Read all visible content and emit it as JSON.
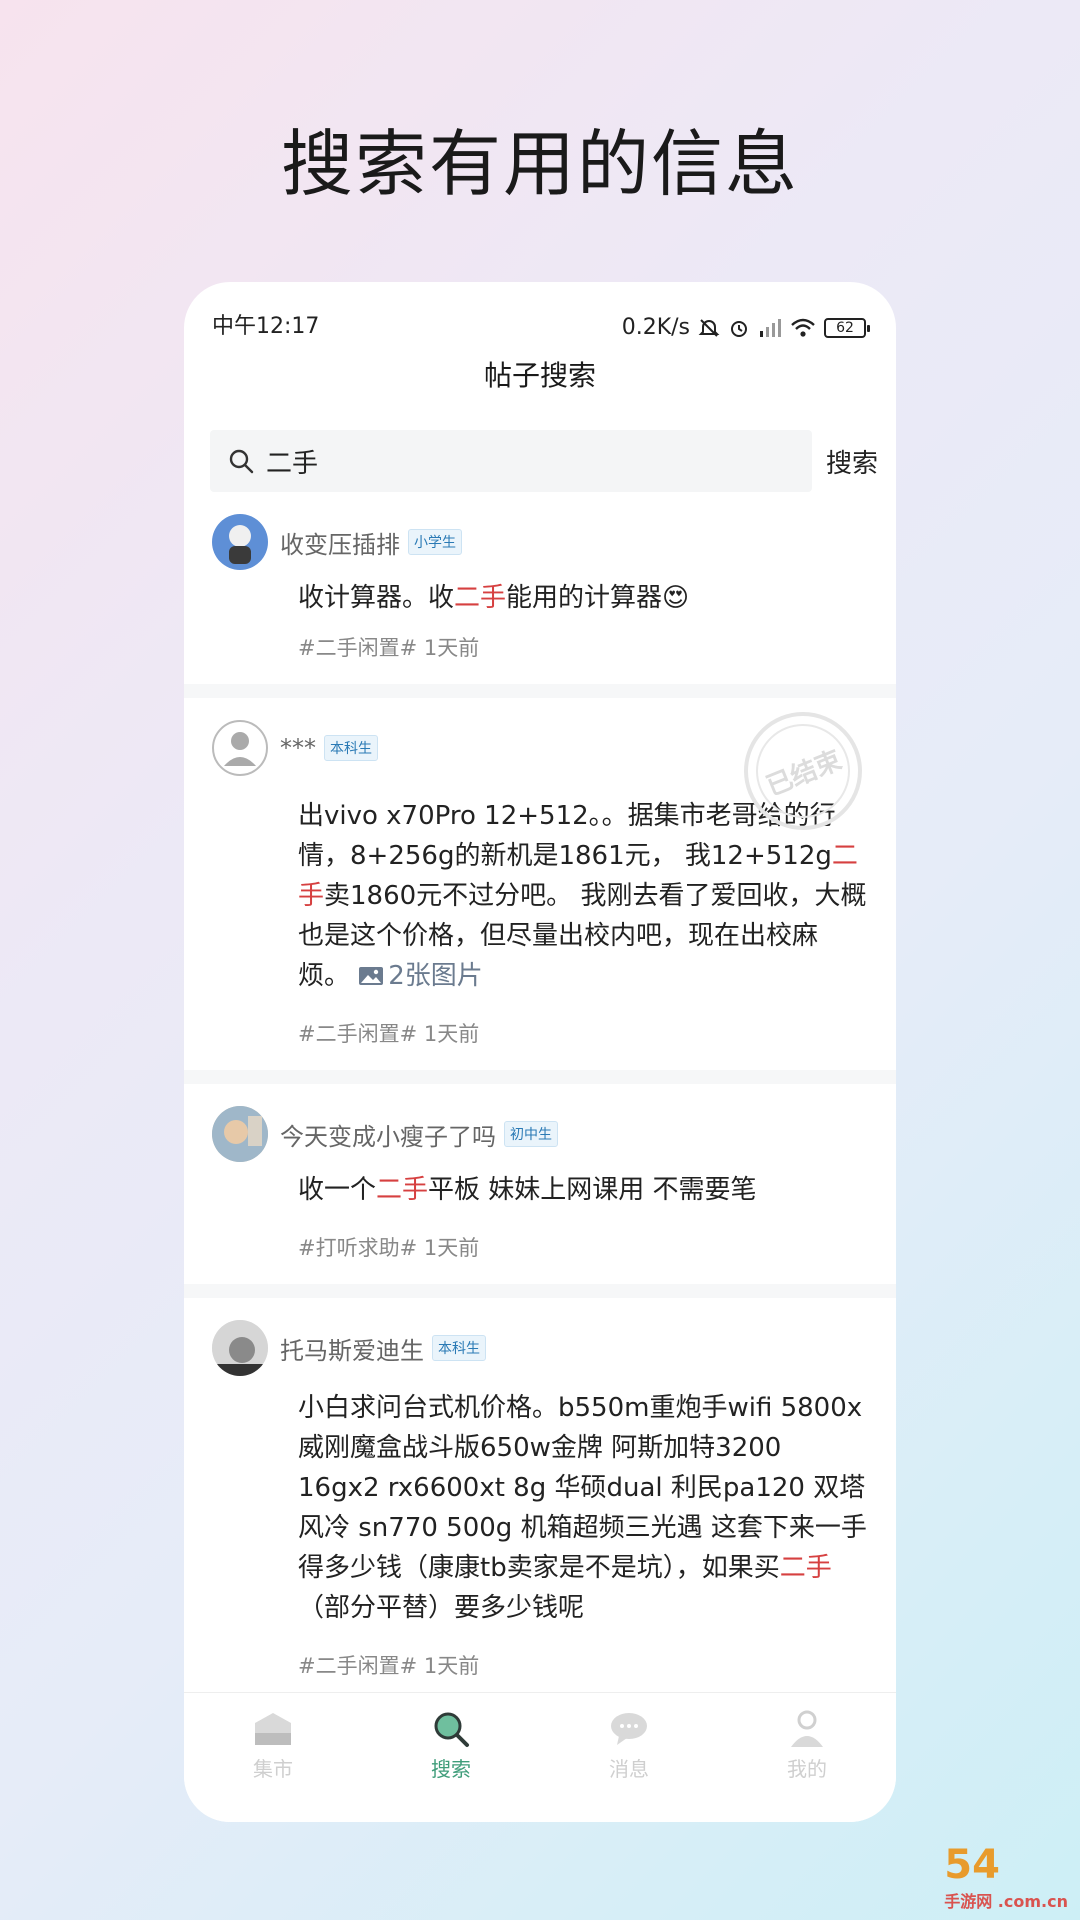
{
  "headline": "搜索有用的信息",
  "status_bar": {
    "time": "中午12:17",
    "net_speed": "0.2K/s",
    "battery": "62"
  },
  "page_title": "帖子搜索",
  "search": {
    "value": "二手",
    "placeholder": "",
    "button_label": "搜索"
  },
  "posts": [
    {
      "author": "收变压插排",
      "badge": "小学生",
      "body_before": "收计算器。收",
      "highlight": "二手",
      "body_after": "能用的计算器😍",
      "tag": "#二手闲置#",
      "time": "1天前"
    },
    {
      "author": "***",
      "badge": "本科生",
      "stamp": "已结束",
      "body_before": "出vivo x70Pro 12+512。。据集市老哥给的行情，8+256g的新机是1861元， 我12+512g",
      "highlight": "二手",
      "body_after": "卖1860元不过分吧。 我刚去看了爱回收，大概也是这个价格，但尽量出校内吧，现在出校麻烦。 ",
      "image_count": "2张图片",
      "tag": "#二手闲置#",
      "time": "1天前"
    },
    {
      "author": "今天变成小瘦子了吗",
      "badge": "初中生",
      "body_before": "收一个",
      "highlight": "二手",
      "body_after": "平板 妹妹上网课用 不需要笔",
      "tag": "#打听求助#",
      "time": "1天前"
    },
    {
      "author": "托马斯爱迪生",
      "badge": "本科生",
      "body_before": "小白求问台式机价格。b550m重炮手wifi 5800x 威刚魔盒战斗版650w金牌 阿斯加特3200 16gx2 rx6600xt 8g 华硕dual 利民pa120 双塔风冷 sn770 500g 机箱超频三光遇 这套下来一手得多少钱（康康tb卖家是不是坑），如果买",
      "highlight": "二手",
      "body_after": "（部分平替）要多少钱呢",
      "tag": "#二手闲置#",
      "time": "1天前"
    }
  ],
  "tabs": [
    {
      "label": "集市",
      "icon": "market-icon",
      "active": false
    },
    {
      "label": "搜索",
      "icon": "search-icon",
      "active": true
    },
    {
      "label": "消息",
      "icon": "message-icon",
      "active": false
    },
    {
      "label": "我的",
      "icon": "profile-icon",
      "active": false
    }
  ],
  "watermark": {
    "brand": "54",
    "site": "手游网 .com.cn"
  },
  "colors": {
    "highlight": "#d64040",
    "active_tab": "#3f9d7a",
    "inactive_tab": "#cfcfcf",
    "badge_text": "#2a7ab5"
  }
}
